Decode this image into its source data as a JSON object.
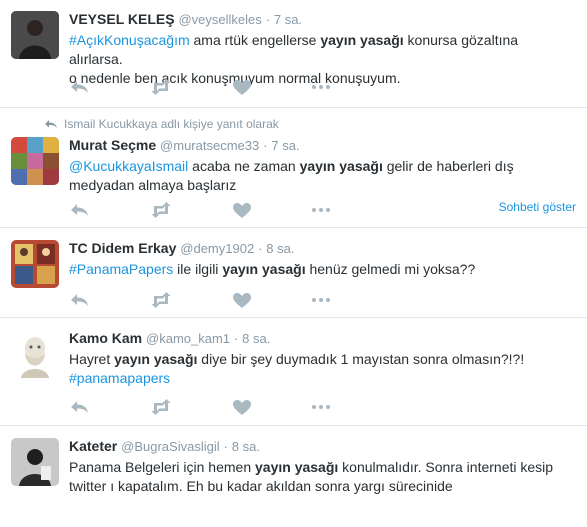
{
  "colors": {
    "link": "#1b95e0",
    "text": "#292f33",
    "muted": "#8899a6",
    "icon": "#aab8c2",
    "divider": "#e1e8ed"
  },
  "tweets": [
    {
      "name": "VEYSEL KELEŞ",
      "handle": "@veysellkeles",
      "dot": "·",
      "time": "7 sa.",
      "avatar_icon": "user-avatar",
      "line1": [
        {
          "t": "#AçıkKonuşacağım",
          "k": "hashtag"
        },
        {
          "t": " ama rtük engellerse ",
          "k": "text"
        },
        {
          "t": "yayın yasağı",
          "k": "bold"
        },
        {
          "t": " konursa gözaltına alırlarsa.",
          "k": "text"
        }
      ],
      "line2": [
        {
          "t": "o nedenle ben acık konuşmuyum normal konuşuyum.",
          "k": "text"
        }
      ]
    },
    {
      "reply_context": "Ismail Kucukkaya adlı kişiye yanıt olarak",
      "name": "Murat Seçme",
      "handle": "@muratsecme33",
      "dot": "·",
      "time": "7 sa.",
      "avatar_icon": "user-avatar",
      "line1": [
        {
          "t": "@KucukkayaIsmail",
          "k": "mention"
        },
        {
          "t": " acaba ne zaman ",
          "k": "text"
        },
        {
          "t": "yayın yasağı",
          "k": "bold"
        },
        {
          "t": " gelir de haberleri dış",
          "k": "text"
        }
      ],
      "line2": [
        {
          "t": "medyadan almaya başlarız",
          "k": "text"
        }
      ],
      "conversation_link": "Sohbeti göster"
    },
    {
      "name": "TC Didem Erkay",
      "handle": "@demy1902",
      "dot": "·",
      "time": "8 sa.",
      "avatar_icon": "user-avatar",
      "line1": [
        {
          "t": "#PanamaPapers",
          "k": "hashtag"
        },
        {
          "t": " ile ilgili ",
          "k": "text"
        },
        {
          "t": "yayın yasağı",
          "k": "bold"
        },
        {
          "t": " henüz gelmedi mi yoksa??",
          "k": "text"
        }
      ],
      "line2": []
    },
    {
      "name": "Kamo Kam",
      "handle": "@kamo_kam1",
      "dot": "·",
      "time": "8 sa.",
      "avatar_icon": "user-avatar",
      "line1": [
        {
          "t": "Hayret ",
          "k": "text"
        },
        {
          "t": "yayın yasağı",
          "k": "bold"
        },
        {
          "t": " diye bir şey duymadık 1 mayıstan sonra olmasın?!?!",
          "k": "text"
        }
      ],
      "line2": [
        {
          "t": "#panamapapers",
          "k": "hashtag"
        }
      ]
    },
    {
      "name": "Kateter",
      "handle": "@BugraSivasligil",
      "dot": "·",
      "time": "8 sa.",
      "avatar_icon": "user-avatar",
      "line1": [
        {
          "t": "Panama Belgeleri için hemen ",
          "k": "text"
        },
        {
          "t": "yayın yasağı",
          "k": "bold"
        },
        {
          "t": " konulmalıdır. Sonra interneti kesip",
          "k": "text"
        }
      ],
      "line2": [
        {
          "t": "twitter ı kapatalım. Eh bu kadar akıldan sonra yargı sürecinide",
          "k": "text"
        }
      ]
    }
  ],
  "action_icons": [
    "reply-icon",
    "retweet-icon",
    "like-icon",
    "more-icon"
  ]
}
